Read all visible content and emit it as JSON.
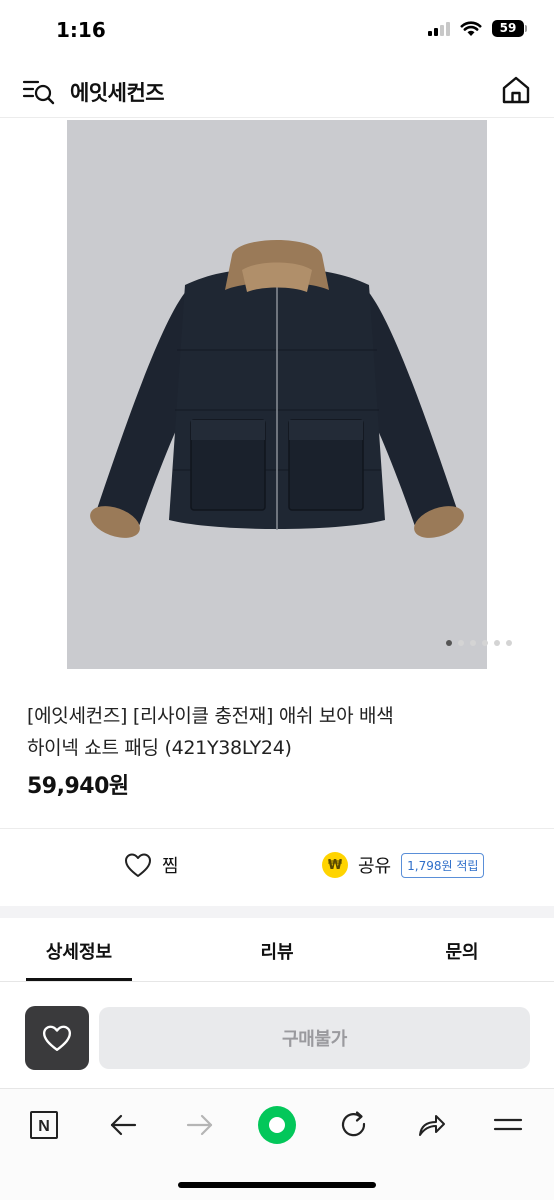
{
  "status_bar": {
    "time": "1:16",
    "battery": "59"
  },
  "header": {
    "brand": "에잇세컨즈"
  },
  "product": {
    "title_line1": "[에잇세컨즈] [리사이클 충전재] 애쉬 보아 배색",
    "title_line2": "하이넥 쇼트 패딩 (421Y38LY24)",
    "price": "59,940원",
    "image_slides": 6,
    "active_slide": 1
  },
  "actions": {
    "like_label": "찜",
    "share_label": "공유",
    "coin_symbol": "₩",
    "reward_badge": "1,798원 적립"
  },
  "tabs": [
    {
      "label": "상세정보",
      "active": true
    },
    {
      "label": "리뷰",
      "active": false
    },
    {
      "label": "문의",
      "active": false
    }
  ],
  "buy_bar": {
    "purchase_label": "구매불가"
  },
  "browser_toolbar": {
    "naver_letter": "N"
  },
  "colors": {
    "coin": "#ffd400",
    "reward_border": "#5a8fd8",
    "naver_green": "#03c75a",
    "wish_button": "#3a3a3c",
    "disabled_button": "#e9eaec"
  }
}
